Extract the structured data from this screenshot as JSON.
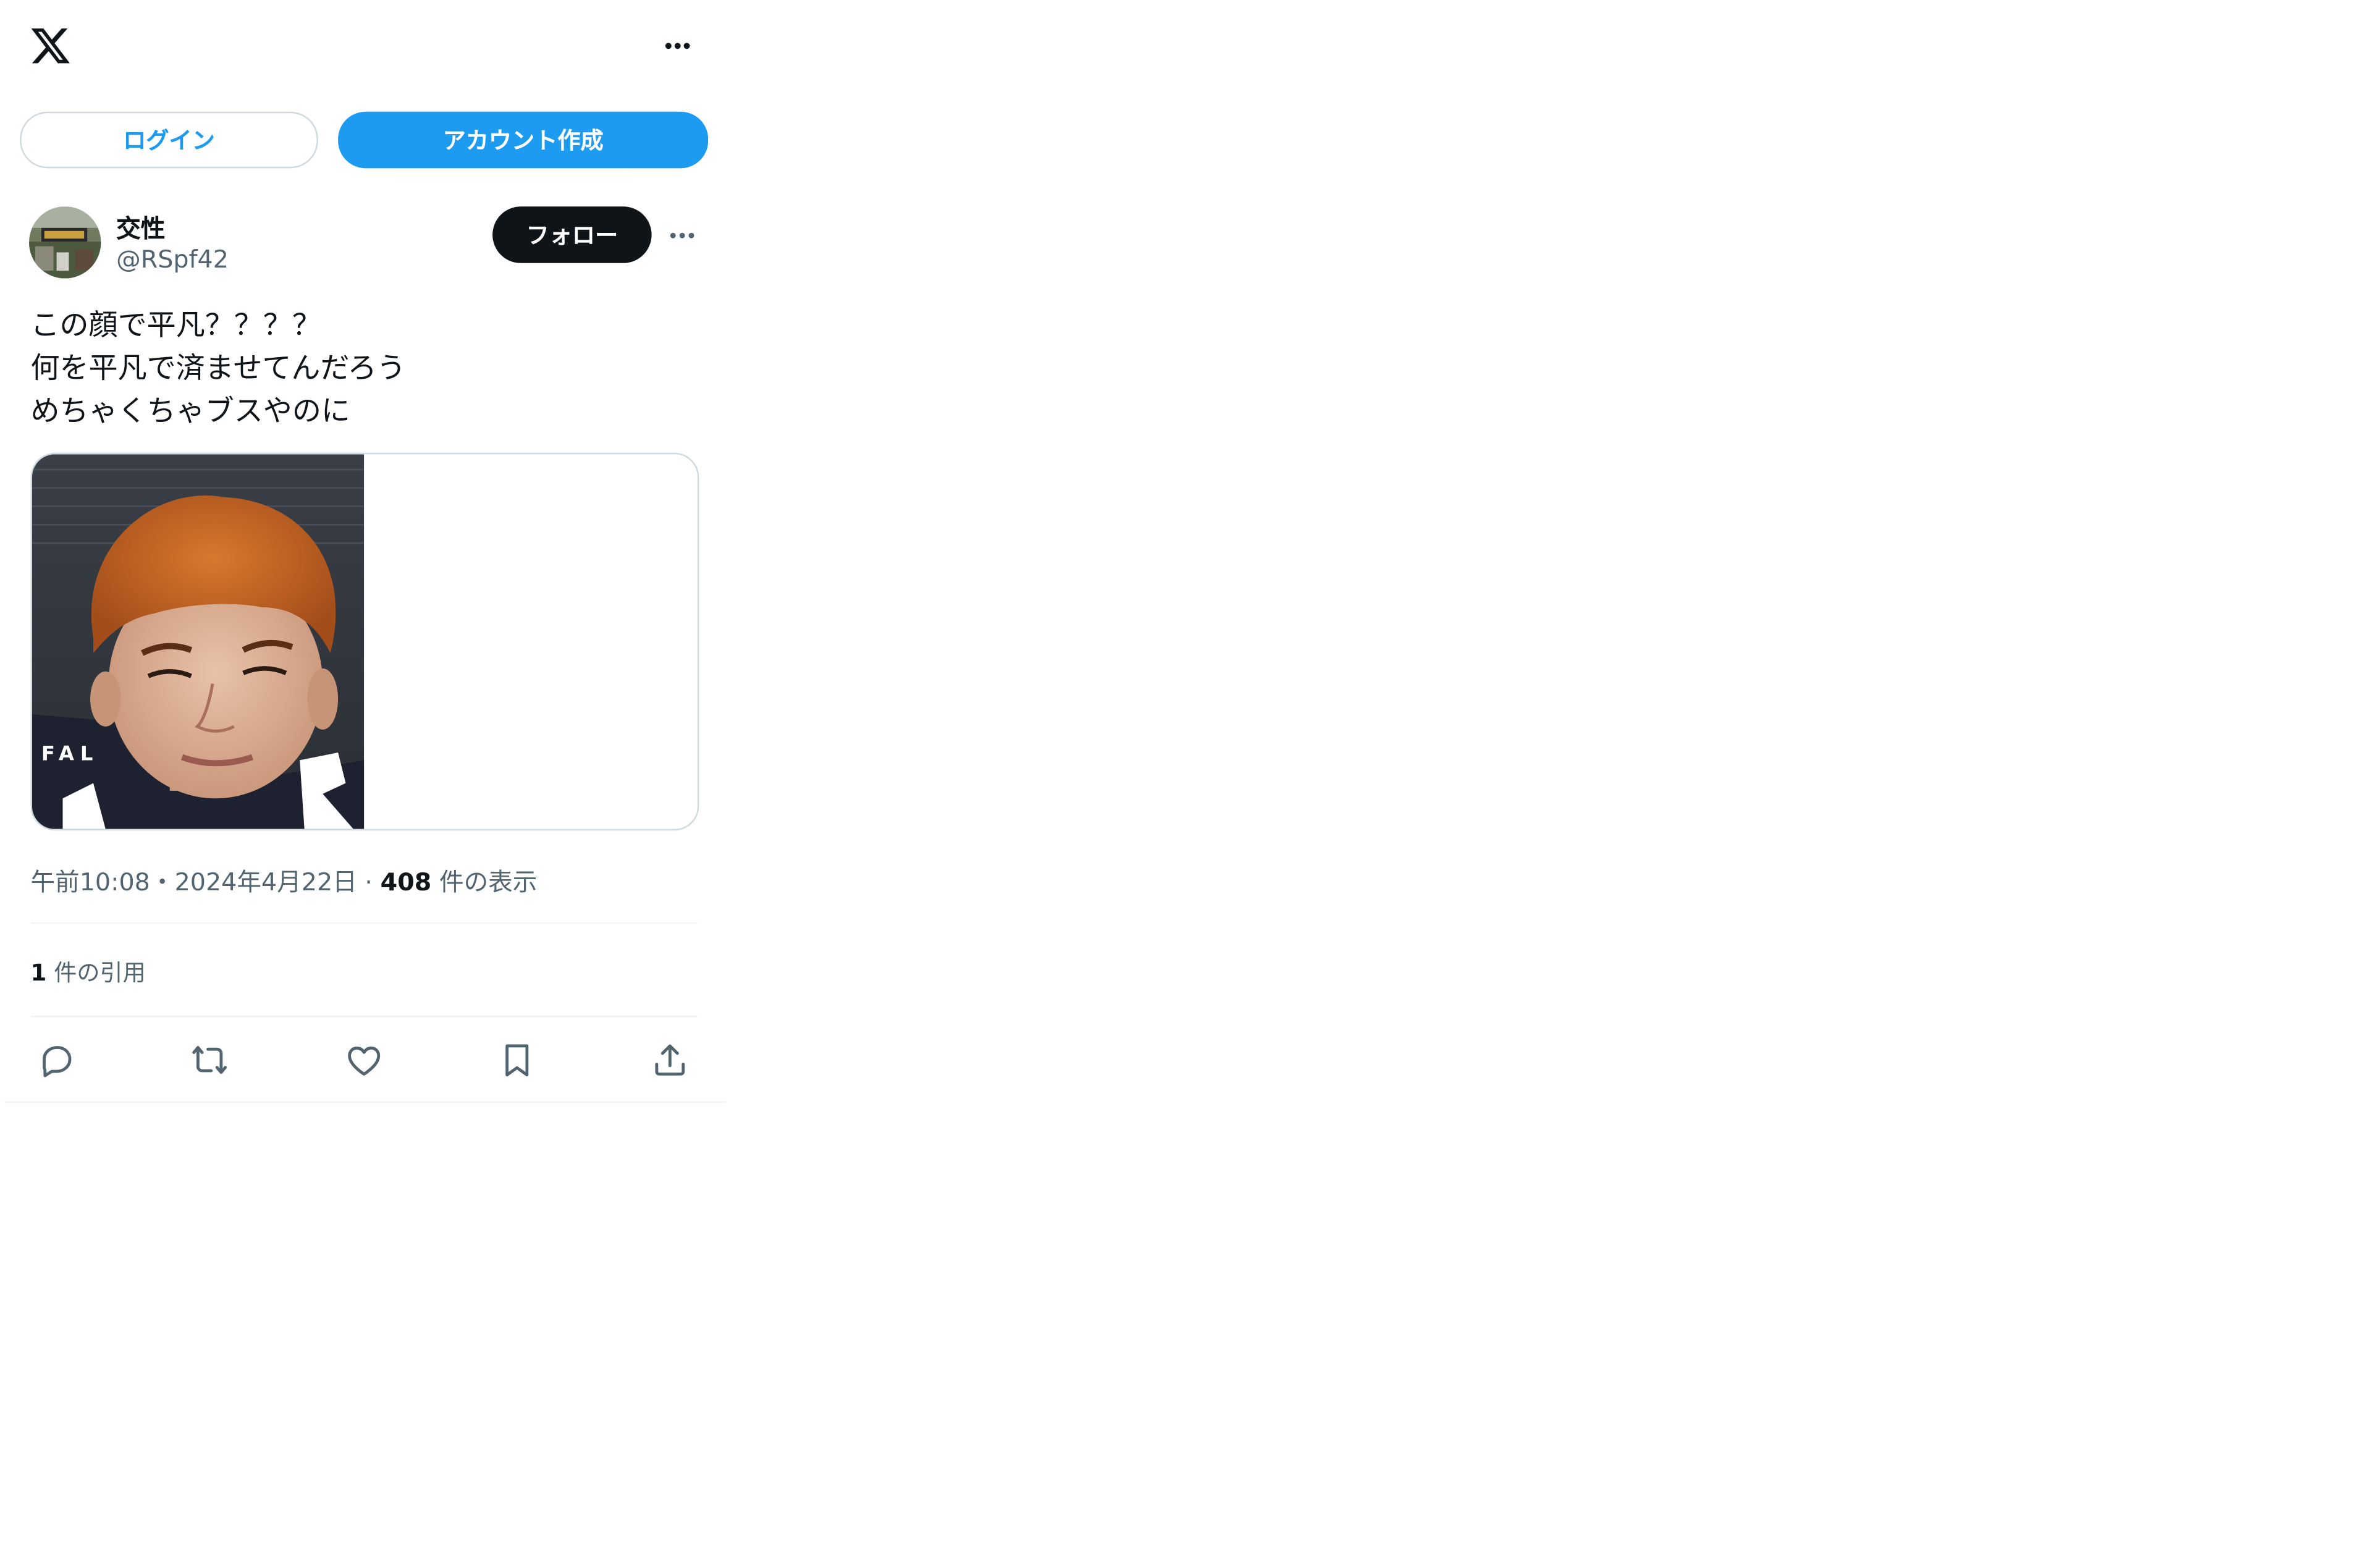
{
  "header": {
    "logo_icon": "x-logo-icon",
    "more_icon": "more-horizontal-icon"
  },
  "auth": {
    "login_label": "ログイン",
    "signup_label": "アカウント作成",
    "accent_color": "#1d9bf0"
  },
  "tweet": {
    "author": {
      "display_name": "交性",
      "handle": "@RSpf42"
    },
    "follow_label": "フォロー",
    "text_lines": [
      "この顔で平凡？？？？",
      "何を平凡で済ませてんだろう",
      "めちゃくちゃブスやのに"
    ],
    "media_alt": "photo",
    "meta": {
      "time": "午前10:08",
      "sep": "・",
      "date": "2024年4月22日",
      "sep2": "·",
      "views_count": "408",
      "views_label": "件の表示"
    },
    "quotes": {
      "count": "1",
      "label": "件の引用"
    },
    "actions": [
      {
        "name": "reply-icon"
      },
      {
        "name": "retweet-icon"
      },
      {
        "name": "like-icon"
      },
      {
        "name": "bookmark-icon"
      },
      {
        "name": "share-icon"
      }
    ]
  }
}
